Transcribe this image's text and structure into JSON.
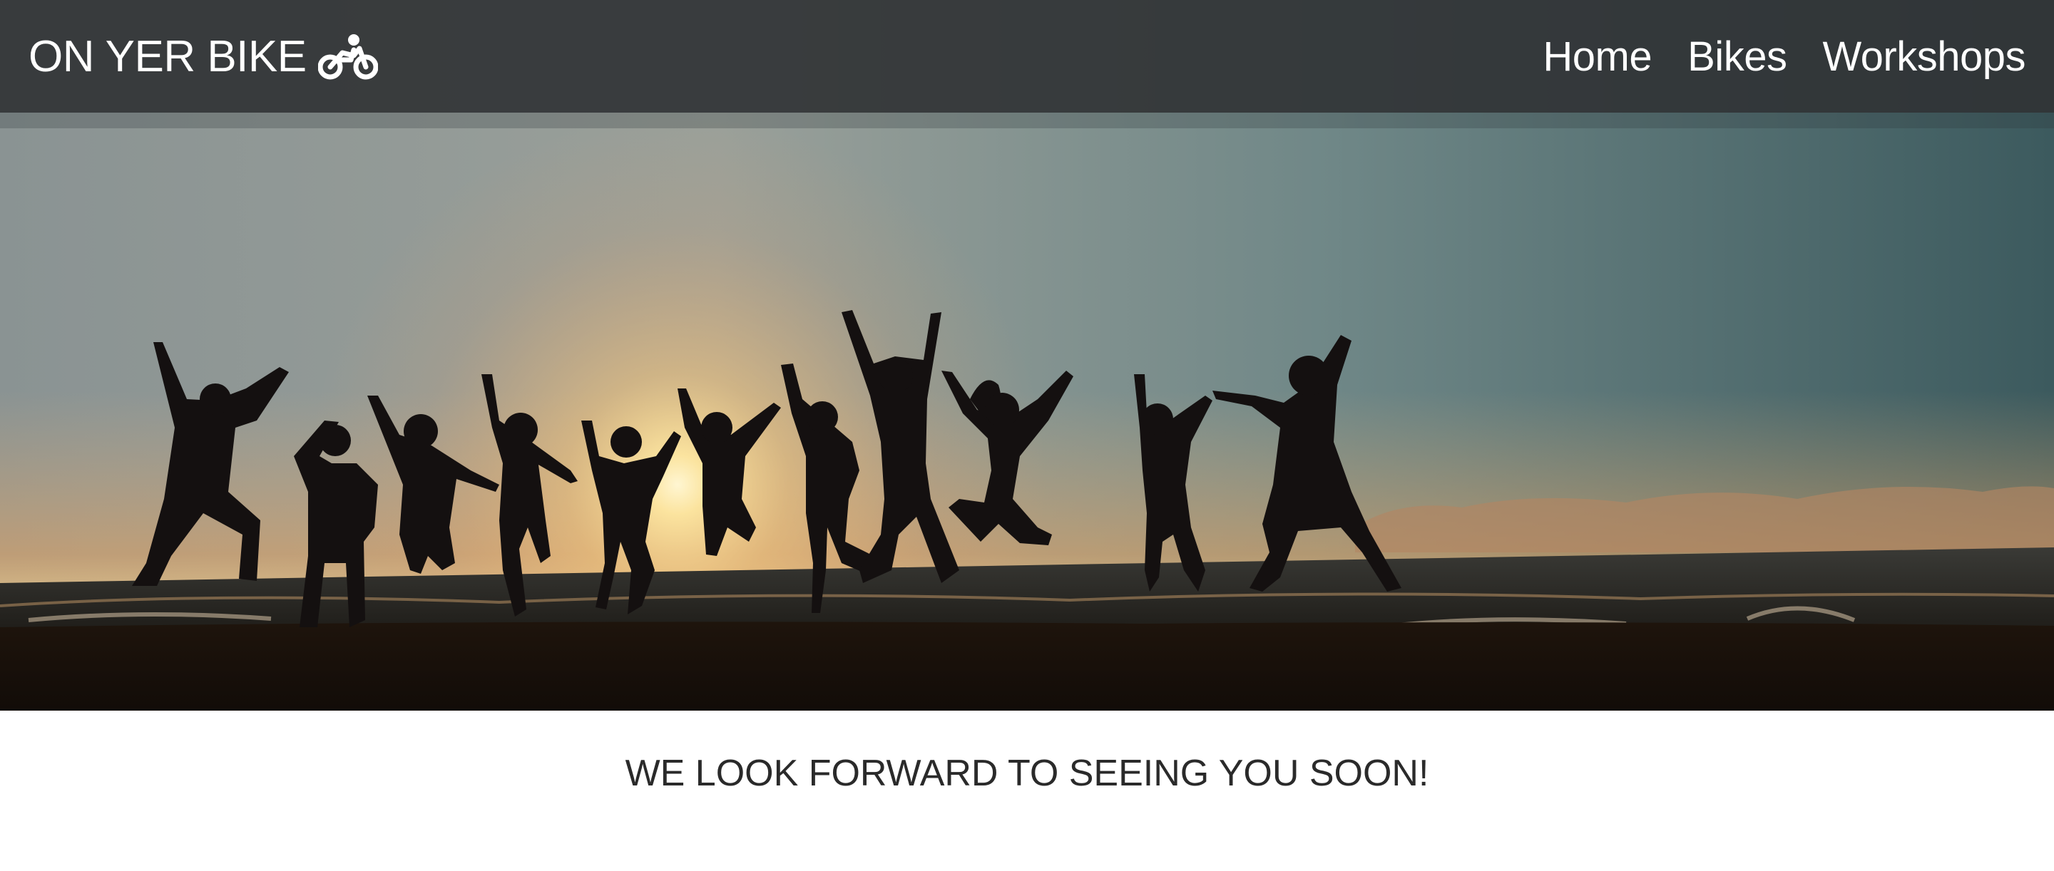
{
  "nav": {
    "brand": "ON YER BIKE",
    "brand_icon": "motorcycle-icon",
    "links": [
      {
        "label": "Home"
      },
      {
        "label": "Bikes"
      },
      {
        "label": "Workshops"
      }
    ]
  },
  "hero": {
    "image": "silhouettes of people jumping on a beach at sunset"
  },
  "tagline": "WE LOOK FORWARD TO SEEING YOU SOON!",
  "colors": {
    "navbar_bg": "#303234",
    "nav_text": "#ffffff",
    "tagline_text": "#2a2a2a"
  }
}
